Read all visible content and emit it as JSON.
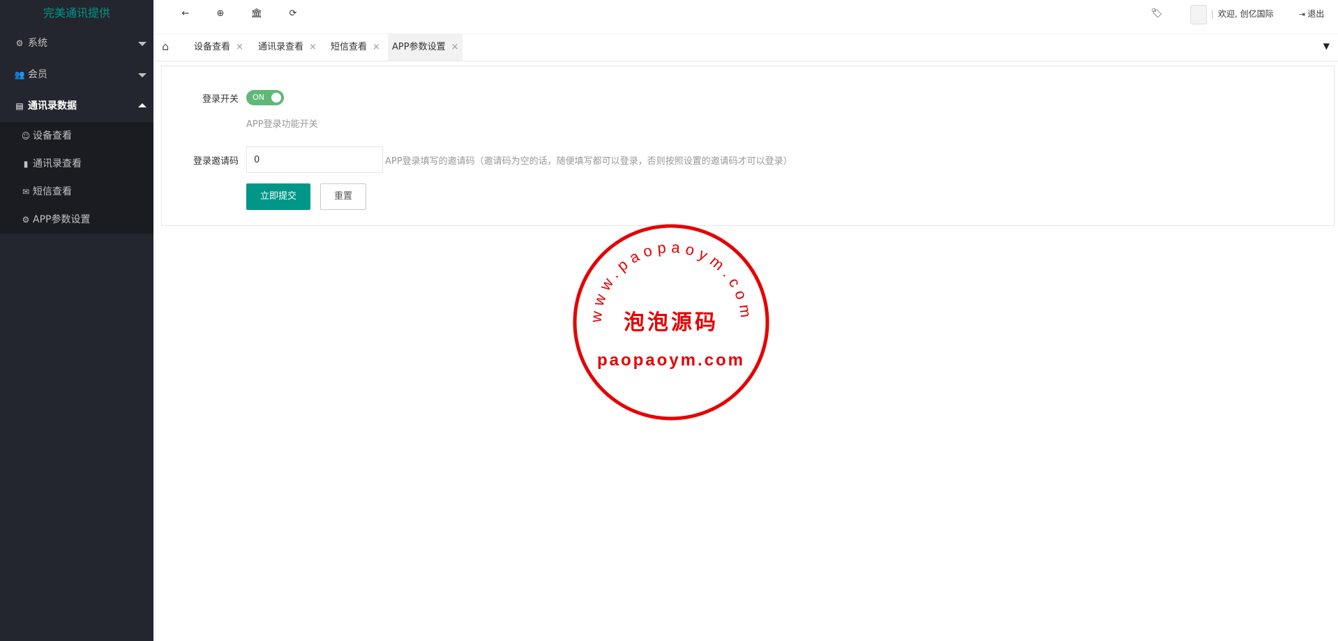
{
  "sidebar": {
    "logo": "完美通讯提供",
    "items": [
      {
        "label": "系统",
        "icon": "gear-icon"
      },
      {
        "label": "会员",
        "icon": "users-icon"
      },
      {
        "label": "通讯录数据",
        "icon": "id-card-icon"
      }
    ],
    "subitems": [
      {
        "label": "设备查看",
        "icon": "user-icon"
      },
      {
        "label": "通讯录查看",
        "icon": "book-icon"
      },
      {
        "label": "短信查看",
        "icon": "envelope-icon"
      },
      {
        "label": "APP参数设置",
        "icon": "gear-icon"
      }
    ]
  },
  "topbar": {
    "welcome": "欢迎, 创亿国际",
    "logout": "退出"
  },
  "tabs": [
    {
      "label": "设备查看",
      "close": "×"
    },
    {
      "label": "通讯录查看",
      "close": "×"
    },
    {
      "label": "短信查看",
      "close": "×"
    },
    {
      "label": "APP参数设置",
      "close": "×"
    }
  ],
  "form": {
    "login_switch_label": "登录开关",
    "switch_text": "ON",
    "switch_hint": "APP登录功能开关",
    "invite_label": "登录邀请码",
    "invite_value": "0",
    "invite_hint": "APP登录填写的邀请码（邀请码为空的话，随便填写都可以登录，否则按照设置的邀请码才可以登录）",
    "submit": "立即提交",
    "reset": "重置"
  },
  "watermark": {
    "arc_text": "www.paopaoym.com",
    "center_text": "泡泡源码",
    "bottom_text": "paopaoym.com",
    "color": "#e60000"
  },
  "colors": {
    "sidebar_bg": "#23262e",
    "accent": "#009688",
    "switch_on": "#5fb878"
  }
}
